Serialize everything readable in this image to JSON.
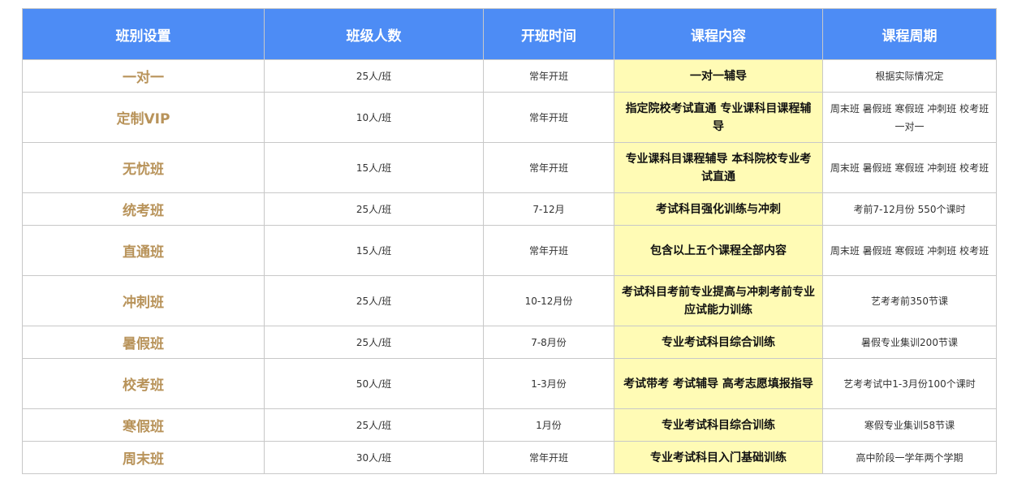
{
  "headers": [
    "班别设置",
    "班级人数",
    "开班时间",
    "课程内容",
    "课程周期"
  ],
  "rows": [
    {
      "name": "一对一",
      "size": "25人/班",
      "time": "常年开班",
      "content": "一对一辅导",
      "period": "根据实际情况定"
    },
    {
      "name": "定制VIP",
      "size": "10人/班",
      "time": "常年开班",
      "content": "指定院校考试直通 专业课科目课程辅导",
      "period": "周末班 暑假班 寒假班 冲刺班 校考班 一对一"
    },
    {
      "name": "无忧班",
      "size": "15人/班",
      "time": "常年开班",
      "content": "专业课科目课程辅导 本科院校专业考试直通",
      "period": "周末班 暑假班 寒假班 冲刺班 校考班"
    },
    {
      "name": "统考班",
      "size": "25人/班",
      "time": "7-12月",
      "content": "考试科目强化训练与冲刺",
      "period": "考前7-12月份 550个课时"
    },
    {
      "name": "直通班",
      "size": "15人/班",
      "time": "常年开班",
      "content": "包含以上五个课程全部内容",
      "period": "周末班 暑假班 寒假班 冲刺班 校考班"
    },
    {
      "name": "冲刺班",
      "size": "25人/班",
      "time": "10-12月份",
      "content": "考试科目考前专业提高与冲刺考前专业应试能力训练",
      "period": "艺考考前350节课"
    },
    {
      "name": "暑假班",
      "size": "25人/班",
      "time": "7-8月份",
      "content": "专业考试科目综合训练",
      "period": "暑假专业集训200节课"
    },
    {
      "name": "校考班",
      "size": "50人/班",
      "time": "1-3月份",
      "content": "考试带考 考试辅导 高考志愿填报指导",
      "period": "艺考考试中1-3月份100个课时"
    },
    {
      "name": "寒假班",
      "size": "25人/班",
      "time": "1月份",
      "content": "专业考试科目综合训练",
      "period": "寒假专业集训58节课"
    },
    {
      "name": "周末班",
      "size": "30人/班",
      "time": "常年开班",
      "content": "专业考试科目入门基础训练",
      "period": "高中阶段一学年两个学期"
    }
  ],
  "colors": {
    "header_bg": "#4d8cf5",
    "header_text": "#ffffff",
    "name_text": "#b8935a",
    "content_bg": "#fffbb5"
  }
}
